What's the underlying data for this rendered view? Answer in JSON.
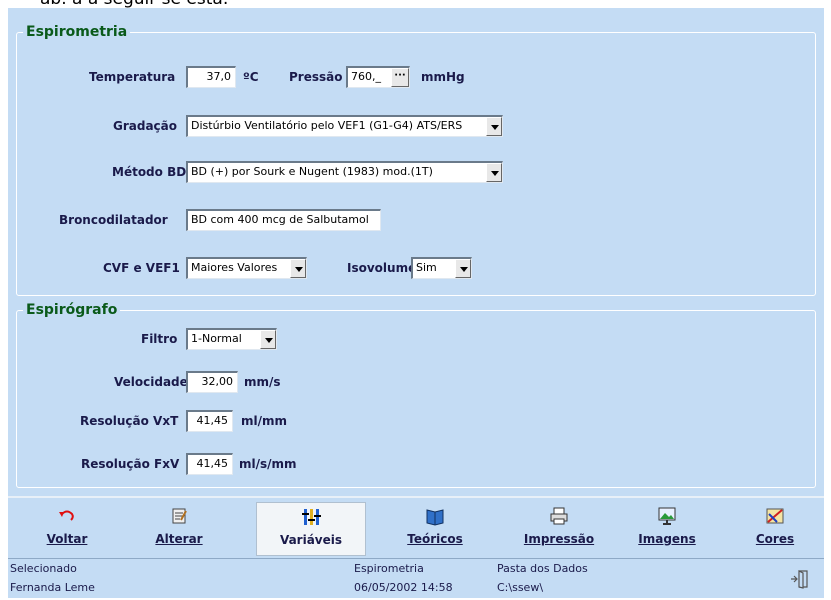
{
  "clipped_text": "ab. a a seguir se está:",
  "spirometry": {
    "legend": "Espirometria",
    "temperature": {
      "label": "Temperatura",
      "value": "37,0",
      "unit": "ºC"
    },
    "pressure": {
      "label": "Pressão",
      "value": "760,_",
      "button": "···",
      "unit": "mmHg"
    },
    "gradation": {
      "label": "Gradação",
      "value": "Distúrbio Ventilatório pelo VEF1 (G1-G4) ATS/ERS"
    },
    "bd_method": {
      "label": "Método BD",
      "value": "BD (+) por Sourk e Nugent (1983) mod.(1T)"
    },
    "bronchodilator": {
      "label": "Broncodilatador",
      "value": "BD com 400 mcg de Salbutamol"
    },
    "cvf_vef1": {
      "label": "CVF e VEF1",
      "value": "Maiores Valores"
    },
    "isovolume": {
      "label": "Isovolume",
      "value": "Sim"
    }
  },
  "spirograph": {
    "legend": "Espirógrafo",
    "filter": {
      "label": "Filtro",
      "value": "1-Normal"
    },
    "speed": {
      "label": "Velocidade",
      "value": "32,00",
      "unit": "mm/s"
    },
    "res_vxt": {
      "label": "Resolução VxT",
      "value": "41,45",
      "unit": "ml/mm"
    },
    "res_fxv": {
      "label": "Resolução FxV",
      "value": "41,45",
      "unit": "ml/s/mm"
    }
  },
  "toolbar": {
    "voltar": "Voltar",
    "alterar": "Alterar",
    "variaveis": "Variáveis",
    "teoricos": "Teóricos",
    "impressao": "Impressão",
    "imagens": "Imagens",
    "cores": "Cores"
  },
  "status": {
    "selected_label": "Selecionado",
    "user": "Fernanda Leme",
    "module": "Espirometria",
    "datetime": "06/05/2002 14:58",
    "data_folder_label": "Pasta dos Dados",
    "data_folder": "C:\\ssew\\"
  },
  "colors": {
    "panel": "#c4dcf4",
    "legend": "#0a5a1a",
    "label": "#1a1a4a"
  }
}
